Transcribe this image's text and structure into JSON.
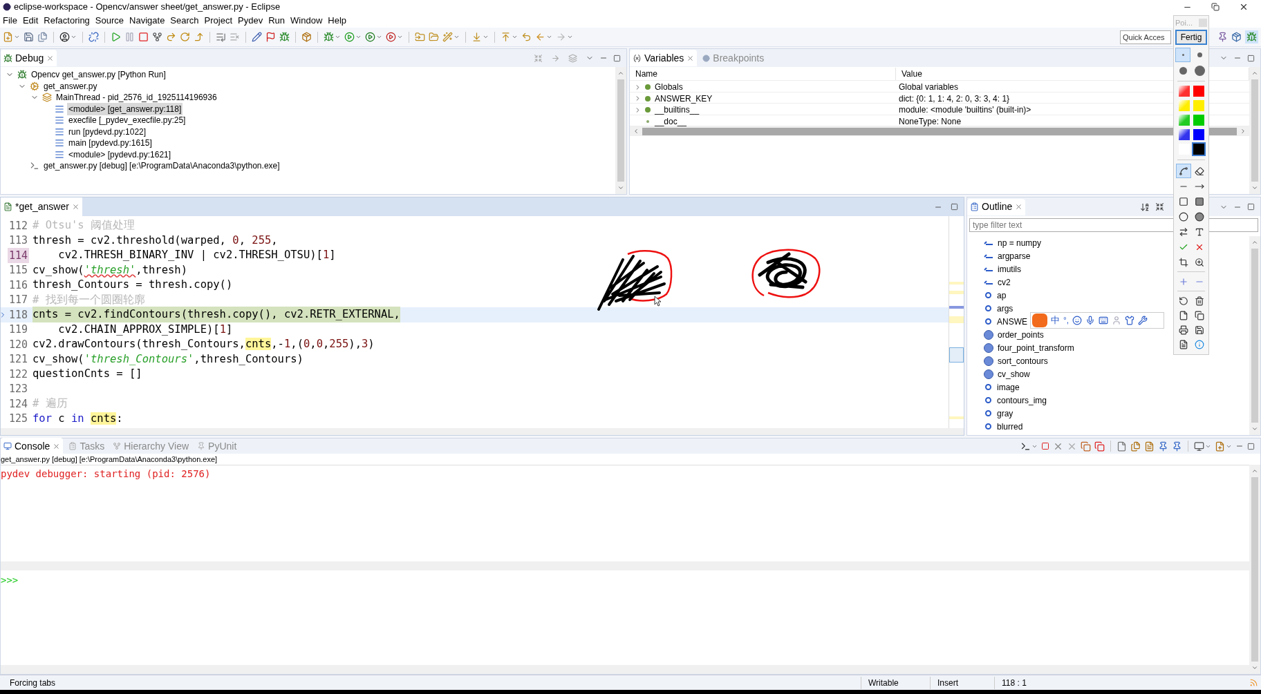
{
  "window": {
    "title": "eclipse-workspace - Opencv/answer sheet/get_answer.py - Eclipse"
  },
  "menu": [
    "File",
    "Edit",
    "Refactoring",
    "Source",
    "Navigate",
    "Search",
    "Project",
    "Pydev",
    "Run",
    "Window",
    "Help"
  ],
  "quick_access": {
    "placeholder": "Quick Acces"
  },
  "debug": {
    "title": "Debug",
    "tree": [
      {
        "label": "Opencv get_answer.py [Python Run]",
        "kind": "launch",
        "expanded": true,
        "selected": false,
        "children": [
          {
            "label": "get_answer.py",
            "kind": "process",
            "expanded": true,
            "selected": false,
            "children": [
              {
                "label": "MainThread - pid_2576_id_1925114196936",
                "kind": "thread",
                "expanded": true,
                "selected": false,
                "children": [
                  {
                    "label": "<module> [get_answer.py:118]",
                    "kind": "frame",
                    "selected": true
                  },
                  {
                    "label": "execfile [_pydev_execfile.py:25]",
                    "kind": "frame",
                    "selected": false
                  },
                  {
                    "label": "run [pydevd.py:1022]",
                    "kind": "frame",
                    "selected": false
                  },
                  {
                    "label": "main [pydevd.py:1615]",
                    "kind": "frame",
                    "selected": false
                  },
                  {
                    "label": "<module> [pydevd.py:1621]",
                    "kind": "frame",
                    "selected": false
                  }
                ]
              }
            ]
          },
          {
            "label": "get_answer.py [debug] [e:\\ProgramData\\Anaconda3\\python.exe]",
            "kind": "exe",
            "selected": false
          }
        ]
      }
    ]
  },
  "variables": {
    "tabs": [
      {
        "label": "Variables",
        "selected": true
      },
      {
        "label": "Breakpoints",
        "selected": false
      }
    ],
    "columns": [
      "Name",
      "Value"
    ],
    "rows": [
      {
        "name": "Globals",
        "value": "Global variables",
        "expandable": true
      },
      {
        "name": "ANSWER_KEY",
        "value": "dict: {0: 1, 1: 4, 2: 0, 3: 3, 4: 1}",
        "expandable": true
      },
      {
        "name": "__builtins__",
        "value": "module: <module 'builtins' (built-in)>",
        "expandable": true
      },
      {
        "name": "__doc__",
        "value": "NoneType: None",
        "expandable": false
      }
    ]
  },
  "editor": {
    "tab": {
      "label": "*get_answer",
      "selected": true
    },
    "lines": [
      {
        "number": "112",
        "current": false,
        "marked": false,
        "segments": [
          {
            "text": "# Otsu's 阈值处理",
            "kind": "comment"
          }
        ]
      },
      {
        "number": "113",
        "current": false,
        "marked": false,
        "segments": [
          {
            "text": "thresh = cv2.threshold(warped, ",
            "kind": "code"
          },
          {
            "text": "0",
            "kind": "number"
          },
          {
            "text": ", ",
            "kind": "code"
          },
          {
            "text": "255",
            "kind": "number"
          },
          {
            "text": ",",
            "kind": "code"
          }
        ]
      },
      {
        "number": "114",
        "current": false,
        "marked": true,
        "segments": [
          {
            "text": "    cv2.THRESH_BINARY_INV | cv2.THRESH_OTSU)[",
            "kind": "code"
          },
          {
            "text": "1",
            "kind": "number"
          },
          {
            "text": "]",
            "kind": "code"
          }
        ]
      },
      {
        "number": "115",
        "current": false,
        "marked": false,
        "segments": [
          {
            "text": "cv_show(",
            "kind": "code"
          },
          {
            "text": "'thresh'",
            "kind": "misspelled"
          },
          {
            "text": ",thresh)",
            "kind": "code"
          }
        ]
      },
      {
        "number": "116",
        "current": false,
        "marked": false,
        "segments": [
          {
            "text": "thresh_Contours = thresh.copy()",
            "kind": "code"
          }
        ]
      },
      {
        "number": "117",
        "current": false,
        "marked": false,
        "segments": [
          {
            "text": "# 找到每一个圆圈轮廓",
            "kind": "comment"
          }
        ]
      },
      {
        "number": "118",
        "current": true,
        "marked": false,
        "segments": [
          {
            "text": "cnts = cv2.findContours(thresh.copy(), cv2.RETR_EXTERNAL,",
            "kind": "code"
          }
        ]
      },
      {
        "number": "119",
        "current": false,
        "marked": false,
        "segments": [
          {
            "text": "    cv2.CHAIN_APPROX_SIMPLE)[",
            "kind": "code"
          },
          {
            "text": "1",
            "kind": "number"
          },
          {
            "text": "]",
            "kind": "code"
          }
        ]
      },
      {
        "number": "120",
        "current": false,
        "marked": false,
        "segments": [
          {
            "text": "cv2.drawContours(thresh_Contours,",
            "kind": "code"
          },
          {
            "text": "cnts",
            "kind": "occurrence"
          },
          {
            "text": ",-",
            "kind": "code"
          },
          {
            "text": "1",
            "kind": "number"
          },
          {
            "text": ",(",
            "kind": "code"
          },
          {
            "text": "0",
            "kind": "number"
          },
          {
            "text": ",",
            "kind": "code"
          },
          {
            "text": "0",
            "kind": "number"
          },
          {
            "text": ",",
            "kind": "code"
          },
          {
            "text": "255",
            "kind": "number"
          },
          {
            "text": "),",
            "kind": "code"
          },
          {
            "text": "3",
            "kind": "number"
          },
          {
            "text": ")",
            "kind": "code"
          }
        ]
      },
      {
        "number": "121",
        "current": false,
        "marked": false,
        "segments": [
          {
            "text": "cv_show(",
            "kind": "code"
          },
          {
            "text": "'thresh_Contours'",
            "kind": "string"
          },
          {
            "text": ",thresh_Contours)",
            "kind": "code"
          }
        ]
      },
      {
        "number": "122",
        "current": false,
        "marked": false,
        "segments": [
          {
            "text": "questionCnts = []",
            "kind": "code"
          }
        ]
      },
      {
        "number": "123",
        "current": false,
        "marked": false
      },
      {
        "number": "124",
        "current": false,
        "marked": false,
        "segments": [
          {
            "text": "# 遍历",
            "kind": "comment"
          }
        ]
      },
      {
        "number": "125",
        "current": false,
        "marked": false,
        "segments": [
          {
            "text": "for",
            "kind": "keyword"
          },
          {
            "text": " c ",
            "kind": "code"
          },
          {
            "text": "in ",
            "kind": "keyword"
          },
          {
            "text": "cnts",
            "kind": "occurrence"
          },
          {
            "text": ":",
            "kind": "code"
          }
        ]
      }
    ]
  },
  "outline": {
    "title": "Outline",
    "filter": {
      "placeholder": "type filter text"
    },
    "items": [
      {
        "label": "np = numpy",
        "kind": "import"
      },
      {
        "label": "argparse",
        "kind": "import"
      },
      {
        "label": "imutils",
        "kind": "import"
      },
      {
        "label": "cv2",
        "kind": "import"
      },
      {
        "label": "ap",
        "kind": "variable"
      },
      {
        "label": "args",
        "kind": "variable"
      },
      {
        "label": "ANSWE",
        "kind": "variable"
      },
      {
        "label": "order_points",
        "kind": "function"
      },
      {
        "label": "four_point_transform",
        "kind": "function"
      },
      {
        "label": "sort_contours",
        "kind": "function"
      },
      {
        "label": "cv_show",
        "kind": "function"
      },
      {
        "label": "image",
        "kind": "variable"
      },
      {
        "label": "contours_img",
        "kind": "variable"
      },
      {
        "label": "gray",
        "kind": "variable"
      },
      {
        "label": "blurred",
        "kind": "variable"
      }
    ]
  },
  "console": {
    "tabs": [
      {
        "label": "Console",
        "selected": true
      },
      {
        "label": "Tasks",
        "selected": false
      },
      {
        "label": "Hierarchy View",
        "selected": false
      },
      {
        "label": "PyUnit",
        "selected": false
      }
    ],
    "process": "get_answer.py [debug] [e:\\ProgramData\\Anaconda3\\python.exe]",
    "output": "pydev debugger: starting (pid: 2576)",
    "prompt": ">>>"
  },
  "status_bar": {
    "message": "Forcing tabs",
    "mode": "Writable",
    "insert": "Insert",
    "position": "118 : 1"
  },
  "palette": {
    "title": "Poi...",
    "done": "Fertig",
    "pen_sizes": [
      {
        "selected": true
      },
      {
        "selected": false
      },
      {
        "selected": false
      },
      {
        "selected": false
      }
    ],
    "colors": [
      {
        "color": "#ff3030",
        "kind": "gradient",
        "selected": false
      },
      {
        "color": "#ff0000",
        "kind": "solid",
        "selected": false
      },
      {
        "color": "#ffee00",
        "kind": "gradient",
        "selected": false
      },
      {
        "color": "#ffee00",
        "kind": "solid",
        "selected": false
      },
      {
        "color": "#22cc22",
        "kind": "gradient",
        "selected": false
      },
      {
        "color": "#00cc00",
        "kind": "solid",
        "selected": false
      },
      {
        "color": "#3333ee",
        "kind": "gradient",
        "selected": false
      },
      {
        "color": "#0000ff",
        "kind": "solid",
        "selected": false
      },
      {
        "color": "#ffffff",
        "kind": "solid",
        "selected": false
      },
      {
        "color": "#000000",
        "kind": "solid",
        "selected": true
      }
    ],
    "tools": [
      {
        "kind": "freehand",
        "selected": true
      },
      {
        "kind": "eraser",
        "selected": false
      },
      {
        "kind": "line",
        "selected": false
      },
      {
        "kind": "arrow",
        "selected": false
      },
      {
        "kind": "rectangle",
        "selected": false
      },
      {
        "kind": "filled-rectangle",
        "selected": false
      },
      {
        "kind": "ellipse",
        "selected": false
      },
      {
        "kind": "filled-ellipse",
        "selected": false
      },
      {
        "kind": "double-arrow",
        "selected": false
      },
      {
        "kind": "text",
        "selected": false
      },
      {
        "kind": "check",
        "selected": false
      },
      {
        "kind": "cross",
        "selected": false
      },
      {
        "kind": "crop",
        "selected": false
      },
      {
        "kind": "zoom",
        "selected": false
      }
    ],
    "actions": [
      {
        "kind": "plus"
      },
      {
        "kind": "minus"
      },
      {
        "kind": "undo"
      },
      {
        "kind": "delete"
      },
      {
        "kind": "new"
      },
      {
        "kind": "copy"
      },
      {
        "kind": "print"
      },
      {
        "kind": "save"
      },
      {
        "kind": "export"
      },
      {
        "kind": "info"
      }
    ]
  },
  "ime": {
    "chinese": "中",
    "punctuation": "°,"
  }
}
